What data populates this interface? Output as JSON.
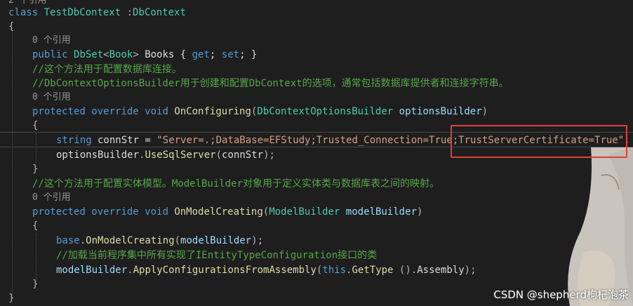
{
  "editor": {
    "codelens_partial": "2 个引用",
    "codelens_refs": "0 个引用",
    "lines": {
      "class_kw": "class",
      "class_name": "TestDbContext",
      "class_colon": " :",
      "class_base": "DbContext",
      "brace_open": "{",
      "brace_close": "}",
      "public_kw": "public",
      "dbset_type": "DbSet",
      "lt": "<",
      "book_type": "Book",
      "gt": ">",
      "books_prop": " Books { ",
      "get_kw": "get",
      "semi_space": "; ",
      "set_kw": "set",
      "prop_end": "; }",
      "comment_config_db": "//这个方法用于配置数据库连接。",
      "comment_options_builder": "//DbContextOptionsBuilder用于创建和配置DbContext的选项，通常包括数据库提供者和连接字符串。",
      "protected_kw": "protected",
      "override_kw": "override",
      "void_kw": "void",
      "on_configuring": "OnConfiguring",
      "paren_open": "(",
      "paren_close": ")",
      "options_builder_type": "DbContextOptionsBuilder",
      "options_builder_param": "optionsBuilder",
      "string_kw": "string",
      "conn_str_decl": " connStr = ",
      "conn_str_value": "\"Server=.;DataBase=EFStudy;Trusted_Connection=True;TrustServerCertificate=True\";",
      "options_builder_var": "optionsBuilder",
      "dot": ".",
      "use_sql_server": "UseSqlServer",
      "conn_str_arg": "connStr",
      "call_end": ");",
      "comment_model_config": "//这个方法用于配置实体模型。ModelBuilder对象用于定义实体类与数据库表之间的映射。",
      "on_model_creating": "OnModelCreating",
      "model_builder_type": "ModelBuilder",
      "model_builder_param": "modelBuilder",
      "base_kw": "base",
      "comment_load_configs": "//加载当前程序集中所有实现了IEntityTypeConfiguration接口的类",
      "model_builder_var": "modelBuilder",
      "apply_configs": "ApplyConfigurationsFromAssembly",
      "this_kw": "this",
      "get_type": "GetType",
      "get_type_call": " ().",
      "assembly_prop": "Assembly"
    }
  },
  "watermark": {
    "text": "CSDN @shepherd枸杞泡茶"
  },
  "colors": {
    "background": "#1e1e1e",
    "keyword": "#569cd6",
    "type": "#4ec9b0",
    "comment": "#57a64a",
    "string": "#d69d85",
    "method": "#dcdcaa",
    "parameter": "#9cdcfe",
    "highlight_box": "#e0403a"
  }
}
